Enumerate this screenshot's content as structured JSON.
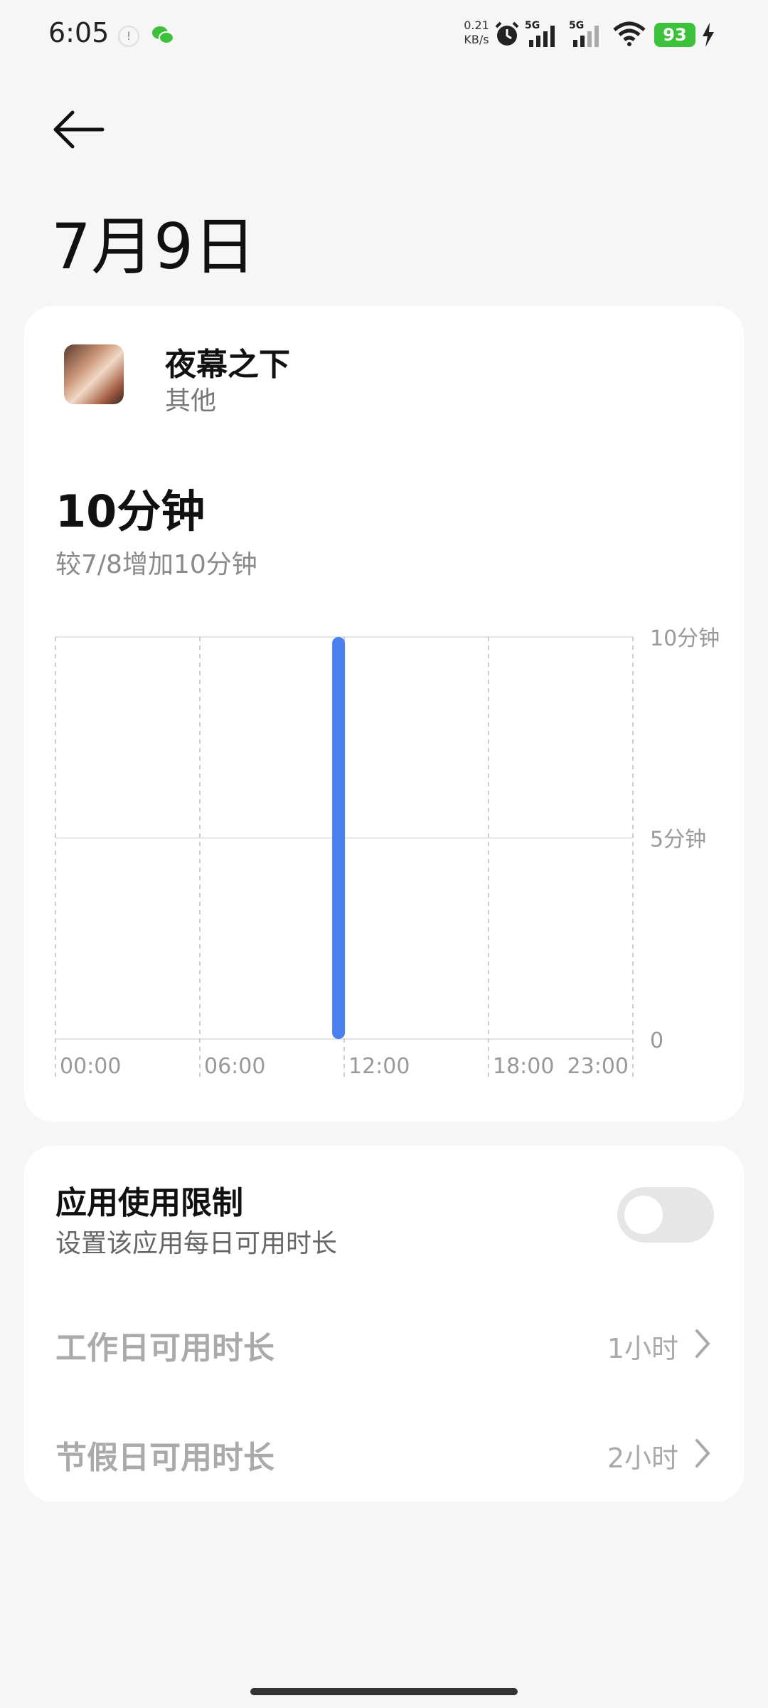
{
  "status_bar": {
    "time": "6:05",
    "net_speed_value": "0.21",
    "net_speed_unit": "KB/s",
    "signal1_label": "5G",
    "signal2_label": "5G",
    "battery": "93",
    "icons": [
      "notification-icon",
      "wechat-icon",
      "alarm-icon",
      "signal-icon",
      "wifi-icon",
      "battery-icon",
      "charging-icon"
    ]
  },
  "header": {
    "title": "7月9日"
  },
  "app": {
    "name": "夜幕之下",
    "category": "其他",
    "total_time": "10分钟",
    "compare_text": "较7/8增加10分钟"
  },
  "chart_data": {
    "type": "bar",
    "title": "",
    "xlabel": "",
    "ylabel": "",
    "x_tick_labels": [
      "00:00",
      "06:00",
      "12:00",
      "18:00",
      "23:00"
    ],
    "y_tick_labels": [
      "10分钟",
      "5分钟",
      "0"
    ],
    "ylim": [
      0,
      10
    ],
    "unit": "分钟",
    "x_hours": [
      0,
      1,
      2,
      3,
      4,
      5,
      6,
      7,
      8,
      9,
      10,
      11,
      12,
      13,
      14,
      15,
      16,
      17,
      18,
      19,
      20,
      21,
      22,
      23
    ],
    "values": [
      0,
      0,
      0,
      0,
      0,
      0,
      0,
      0,
      0,
      0,
      0,
      10,
      0,
      0,
      0,
      0,
      0,
      0,
      0,
      0,
      0,
      0,
      0,
      0
    ],
    "bar_color": "#4a7ff0",
    "grid": true
  },
  "limits": {
    "title": "应用使用限制",
    "subtitle": "设置该应用每日可用时长",
    "toggle_on": false,
    "rows": [
      {
        "label": "工作日可用时长",
        "value": "1小时"
      },
      {
        "label": "节假日可用时长",
        "value": "2小时"
      }
    ]
  }
}
